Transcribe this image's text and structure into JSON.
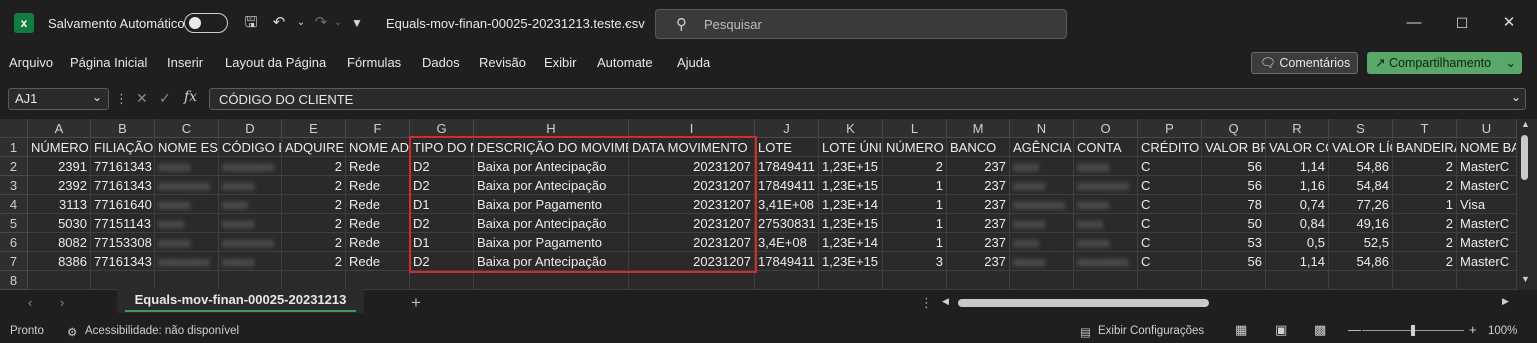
{
  "titlebar": {
    "autosave_label": "Salvamento Automático",
    "filename": "Equals-mov-finan-00025-20231213.teste.csv",
    "search_placeholder": "Pesquisar"
  },
  "menu": [
    "Arquivo",
    "Página Inicial",
    "Inserir",
    "Layout da Página",
    "Fórmulas",
    "Dados",
    "Revisão",
    "Exibir",
    "Automate",
    "Ajuda"
  ],
  "buttons": {
    "comments": "Comentários",
    "share": "Compartilhamento"
  },
  "formula_bar": {
    "name_box": "AJ1",
    "formula": "CÓDIGO DO CLIENTE"
  },
  "columns": [
    "A",
    "B",
    "C",
    "D",
    "E",
    "F",
    "G",
    "H",
    "I",
    "J",
    "K",
    "L",
    "M",
    "N",
    "O",
    "P",
    "Q",
    "R",
    "S",
    "T",
    "U"
  ],
  "rows": [
    "1",
    "2",
    "3",
    "4",
    "5",
    "6",
    "7",
    "8"
  ],
  "headers": [
    "NÚMERO S",
    "FILIAÇÃO I",
    "NOME EST",
    "CÓDIGO E",
    "ADQUIREN",
    "NOME ADC",
    "TIPO DO M",
    "DESCRIÇÃO DO MOVIMEN",
    "DATA MOVIMENTO",
    "LOTE",
    "LOTE ÚNIC",
    "NÚMERO I",
    "BANCO",
    "AGÊNCIA",
    "CONTA",
    "CRÉDITO C",
    "VALOR BR",
    "VALOR CO",
    "VALOR LÍC",
    "BANDEIRA",
    "NOME BA"
  ],
  "data_rows": [
    [
      "2391",
      "77161343",
      "",
      "",
      "2",
      "Rede",
      "D2",
      "Baixa por Antecipação",
      "20231207",
      "17849411",
      "1,23E+15",
      "2",
      "237",
      "",
      "",
      "C",
      "56",
      "1,14",
      "54,86",
      "2",
      "MasterC"
    ],
    [
      "2392",
      "77161343",
      "",
      "",
      "2",
      "Rede",
      "D2",
      "Baixa por Antecipação",
      "20231207",
      "17849411",
      "1,23E+15",
      "1",
      "237",
      "",
      "",
      "C",
      "56",
      "1,16",
      "54,84",
      "2",
      "MasterC"
    ],
    [
      "3113",
      "77161640",
      "",
      "",
      "2",
      "Rede",
      "D1",
      "Baixa por Pagamento",
      "20231207",
      "3,41E+08",
      "1,23E+14",
      "1",
      "237",
      "",
      "",
      "C",
      "78",
      "0,74",
      "77,26",
      "1",
      "Visa"
    ],
    [
      "5030",
      "77151143",
      "",
      "",
      "2",
      "Rede",
      "D2",
      "Baixa por Antecipação",
      "20231207",
      "27530831",
      "1,23E+15",
      "1",
      "237",
      "",
      "",
      "C",
      "50",
      "0,84",
      "49,16",
      "2",
      "MasterC"
    ],
    [
      "8082",
      "77153308",
      "",
      "",
      "2",
      "Rede",
      "D1",
      "Baixa por Pagamento",
      "20231207",
      "3,4E+08",
      "1,23E+14",
      "1",
      "237",
      "",
      "",
      "C",
      "53",
      "0,5",
      "52,5",
      "2",
      "MasterC"
    ],
    [
      "8386",
      "77161343",
      "",
      "",
      "2",
      "Rede",
      "D2",
      "Baixa por Antecipação",
      "20231207",
      "17849411",
      "1,23E+15",
      "3",
      "237",
      "",
      "",
      "C",
      "56",
      "1,14",
      "54,86",
      "2",
      "MasterC"
    ]
  ],
  "sheet_tab": "Equals-mov-finan-00025-20231213",
  "status": {
    "ready": "Pronto",
    "accessibility": "Acessibilidade: não disponível",
    "display_settings": "Exibir Configurações",
    "zoom": "100%"
  }
}
